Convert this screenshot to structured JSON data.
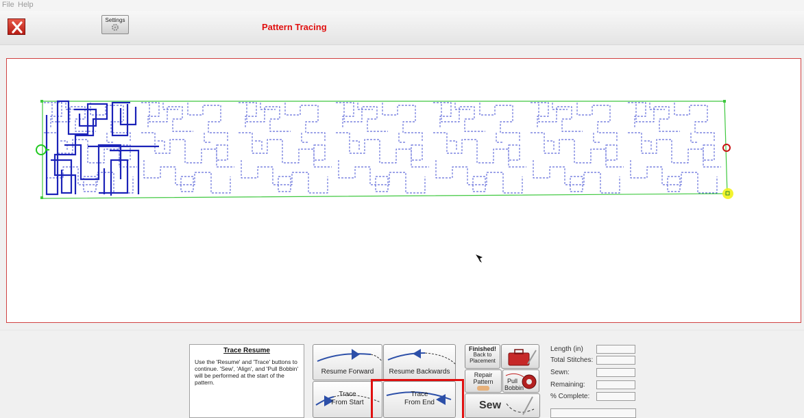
{
  "menu": {
    "file": "File",
    "help": "Help"
  },
  "toolbar": {
    "settings_label": "Settings",
    "title": "Pattern Tracing"
  },
  "info": {
    "title": "Trace Resume",
    "body": "Use the 'Resume' and 'Trace' buttons to continue. 'Sew', 'Align', and 'Pull Bobbin' will be performed at the start of the pattern."
  },
  "controls": {
    "resume_forward": "Resume Forward",
    "resume_backwards": "Resume Backwards",
    "trace_from_start_1": "Trace",
    "trace_from_start_2": "From Start",
    "trace_from_end_1": "Trace",
    "trace_from_end_2": "From End"
  },
  "functions": {
    "finished": "Finished!",
    "back_to": "Back to",
    "placement": "Placement",
    "repair_1": "Repair",
    "repair_2": "Pattern",
    "pull": "Pull",
    "bobbin": "Bobbin",
    "sew": "Sew"
  },
  "stats": {
    "length": "Length (in)",
    "total_stitches": "Total Stitches:",
    "sewn": "Sewn:",
    "remaining": "Remaining:",
    "percent_complete": "% Complete:"
  },
  "colors": {
    "title_red": "#e01010",
    "traced_blue": "#1a22b8",
    "dashed_blue": "#3a46d0",
    "bounds_green": "#3ec83e"
  }
}
